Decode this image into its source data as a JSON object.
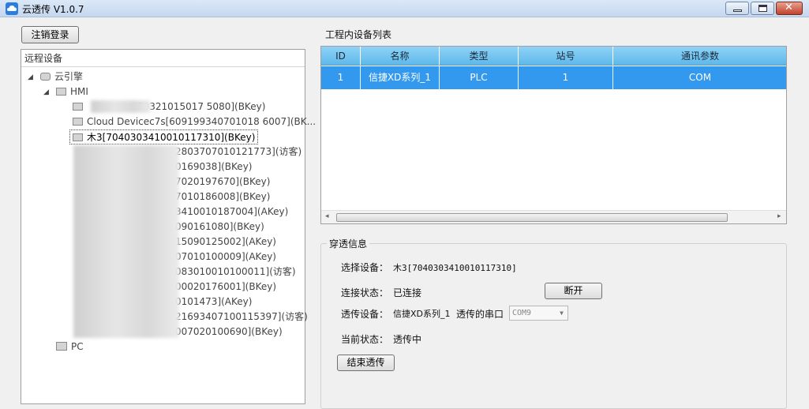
{
  "window": {
    "title": "云透传 V1.0.7",
    "controls": {
      "min": "",
      "max": "",
      "close": "✕"
    }
  },
  "toolbar": {
    "logout_label": "注销登录"
  },
  "tree": {
    "header": "远程设备",
    "root": {
      "label": "云引擎",
      "expander": "◢"
    },
    "hmi": {
      "label": "HMI",
      "expander": "◢"
    },
    "items": [
      {
        "label": "79321015017 5080](BKey)"
      },
      {
        "label": "Cloud Devicec7s[609199340701018 6007](BK..."
      },
      {
        "label": "木3[7040303410010117310](BKey)"
      },
      {
        "label": "2803707010121773](访客)"
      },
      {
        "label": "0169038](BKey)"
      },
      {
        "label": "7020197670](BKey)"
      },
      {
        "label": "7010186008](BKey)"
      },
      {
        "label": "3410010187004](AKey)"
      },
      {
        "label": "090161080](BKey)"
      },
      {
        "label": "15090125002](AKey)"
      },
      {
        "label": "07010100009](AKey)"
      },
      {
        "label": "083010010100011](访客)"
      },
      {
        "label": "00020176001](BKey)"
      },
      {
        "label": "0101473](AKey)"
      },
      {
        "label": "21693407100115397](访客)"
      },
      {
        "label": "007020100690](BKey)"
      }
    ],
    "pc": {
      "label": "PC"
    }
  },
  "device_list": {
    "title": "工程内设备列表",
    "columns": [
      "ID",
      "名称",
      "类型",
      "站号",
      "通讯参数"
    ],
    "rows": [
      {
        "id": "1",
        "name": "信捷XD系列_1",
        "type": "PLC",
        "station": "1",
        "comm": "COM"
      }
    ],
    "scroll_left": "◂",
    "scroll_right": "▸"
  },
  "passthrough": {
    "title": "穿透信息",
    "select_device_label": "选择设备：",
    "select_device_value": "木3[7040303410010117310]",
    "conn_status_label": "连接状态：",
    "conn_status_value": "已连接",
    "disconnect_label": "断开",
    "trans_device_label": "透传设备：",
    "trans_device_value": "信捷XD系列_1",
    "port_label": "透传的串口",
    "port_value": "COM9",
    "current_status_label": "当前状态：",
    "current_status_value": "透传中",
    "end_label": "结束透传"
  }
}
